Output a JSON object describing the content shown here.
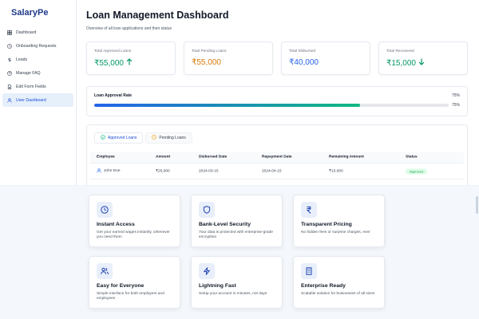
{
  "brand": "SalaryPe",
  "sidebar": {
    "items": [
      {
        "label": "Dashboard",
        "icon": "grid-icon",
        "active": false
      },
      {
        "label": "Onboarding Requests",
        "icon": "clock-icon",
        "active": false
      },
      {
        "label": "Leads",
        "icon": "dollar-icon",
        "active": false
      },
      {
        "label": "Manage FAQ",
        "icon": "help-circle-icon",
        "active": false
      },
      {
        "label": "Edit Form Fields",
        "icon": "file-edit-icon",
        "active": false
      },
      {
        "label": "User Dashboard",
        "icon": "user-icon",
        "active": true
      }
    ]
  },
  "header": {
    "title": "Loan Management Dashboard",
    "subtitle": "Overview of all loan applications and their status"
  },
  "stats": [
    {
      "label": "Total Approved Loans",
      "value": "₹55,000",
      "color": "#059669",
      "arrow": "up"
    },
    {
      "label": "Total Pending Loans",
      "value": "₹55,000",
      "color": "#d97706",
      "arrow": ""
    },
    {
      "label": "Total Disbursed",
      "value": "₹40,000",
      "color": "#2563eb",
      "arrow": ""
    },
    {
      "label": "Total Recovered",
      "value": "₹15,000",
      "color": "#059669",
      "arrow": "down"
    }
  ],
  "approval": {
    "label": "Loan Approval Rate",
    "percent_text": "75%",
    "percent_text_2": "75%",
    "value": 75
  },
  "loans": {
    "tabs": [
      {
        "label": "Approved Loans",
        "active": true
      },
      {
        "label": "Pending Loans",
        "active": false
      }
    ],
    "columns": [
      "Employee",
      "Amount",
      "Disbursed Date",
      "Repayment Date",
      "Remaining Amount",
      "Status"
    ],
    "rows": [
      {
        "employee": "John Doe",
        "amount": "₹25,000",
        "disbursed": "2024-03-15",
        "repayment": "2024-04-15",
        "remaining": "₹15,000",
        "status": "Approved"
      }
    ]
  },
  "features": [
    {
      "title": "Instant Access",
      "desc": "Get your earned wages instantly, whenever you need them",
      "icon": "clock-icon"
    },
    {
      "title": "Bank-Level Security",
      "desc": "Your data is protected with enterprise-grade encryption",
      "icon": "shield-icon"
    },
    {
      "title": "Transparent Pricing",
      "desc": "No hidden fees or surprise charges, ever",
      "icon": "rupee-icon"
    },
    {
      "title": "Easy for Everyone",
      "desc": "Simple interface for both employers and employees",
      "icon": "users-icon"
    },
    {
      "title": "Lightning Fast",
      "desc": "Setup your account in minutes, not days",
      "icon": "bolt-icon"
    },
    {
      "title": "Enterprise Ready",
      "desc": "Scalable solution for businesses of all sizes",
      "icon": "building-icon"
    }
  ],
  "colors": {
    "accent": "#2563eb",
    "brand": "#1e3a8a"
  }
}
